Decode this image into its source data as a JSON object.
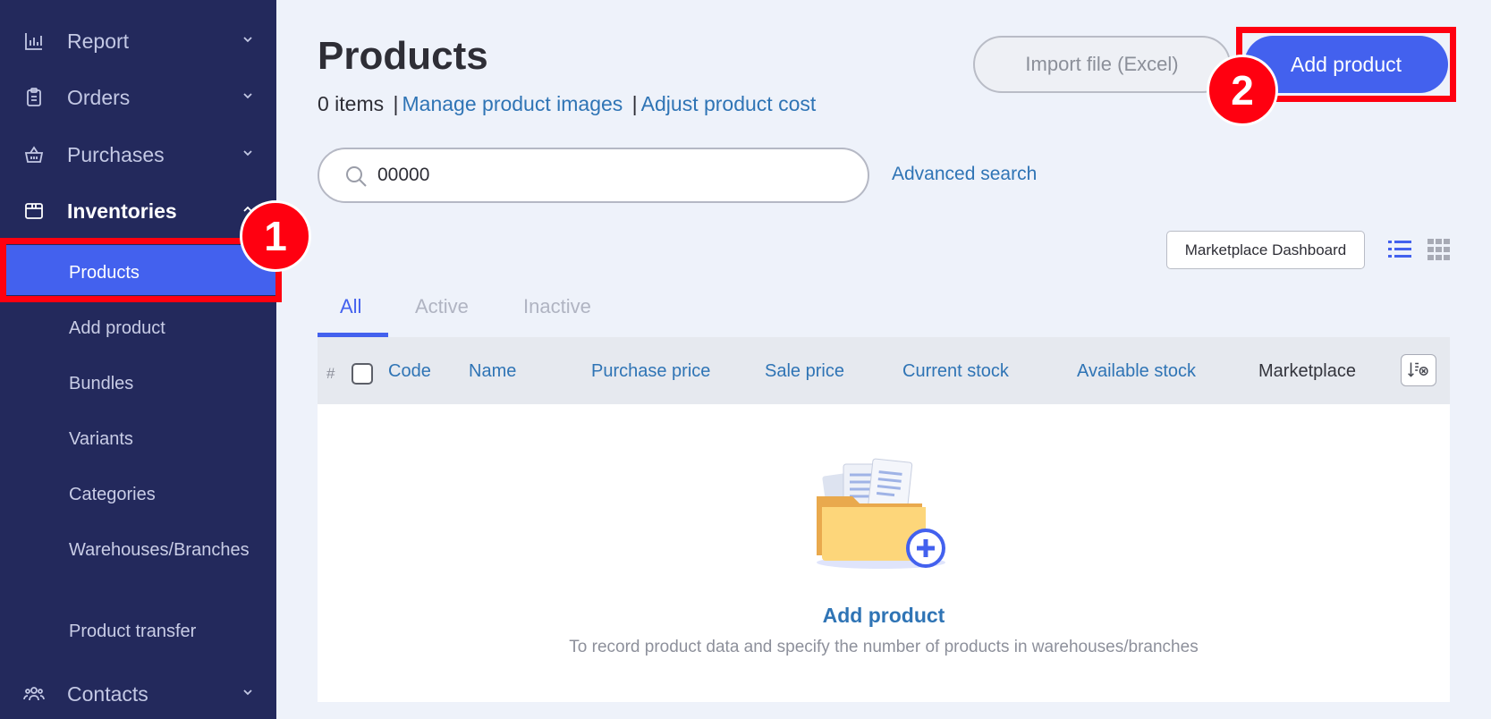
{
  "sidebar": {
    "groups": [
      {
        "label": "Report",
        "icon": "bar-chart-icon"
      },
      {
        "label": "Orders",
        "icon": "clipboard-icon"
      },
      {
        "label": "Purchases",
        "icon": "basket-icon"
      },
      {
        "label": "Inventories",
        "icon": "box-icon"
      },
      {
        "label": "Contacts",
        "icon": "users-icon"
      }
    ],
    "sub_items": [
      {
        "label": "Products"
      },
      {
        "label": "Add product"
      },
      {
        "label": "Bundles"
      },
      {
        "label": "Variants"
      },
      {
        "label": "Categories"
      },
      {
        "label": "Warehouses/Branches"
      },
      {
        "label": "Product transfer"
      }
    ],
    "active_item": "Products"
  },
  "header": {
    "title": "Products",
    "count_text": "0 items",
    "separator": "|",
    "manage_images_link": "Manage product images",
    "adjust_cost_link": "Adjust product cost",
    "import_button": "Import file (Excel)",
    "add_button": "Add product"
  },
  "search": {
    "value": "00000",
    "advanced_link": "Advanced search"
  },
  "toolbar": {
    "marketplace_dashboard": "Marketplace Dashboard"
  },
  "tabs": [
    {
      "label": "All",
      "active": true
    },
    {
      "label": "Active",
      "active": false
    },
    {
      "label": "Inactive",
      "active": false
    }
  ],
  "table": {
    "hash": "#",
    "columns": [
      "Code",
      "Name",
      "Purchase price",
      "Sale price",
      "Current stock",
      "Available stock",
      "Marketplace"
    ]
  },
  "empty_state": {
    "title": "Add product",
    "description": "To record product data and specify the number of products in warehouses/branches"
  },
  "annotations": {
    "step1": "1",
    "step2": "2"
  },
  "colors": {
    "sidebar_bg": "#23295c",
    "accent": "#4361ee",
    "link": "#2f74b5",
    "highlight": "#ff0010"
  }
}
